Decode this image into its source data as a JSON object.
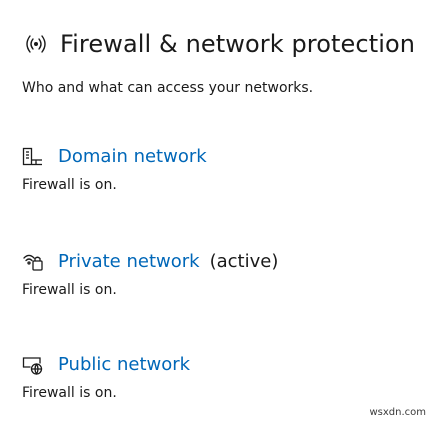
{
  "header": {
    "icon": "wifi-signal-icon",
    "title": "Firewall & network protection"
  },
  "subtitle": "Who and what can access your networks.",
  "networks": [
    {
      "icon": "domain-network-icon",
      "name": "Domain network",
      "active_label": "",
      "status": "Firewall is on."
    },
    {
      "icon": "private-network-icon",
      "name": "Private network",
      "active_label": "(active)",
      "status": "Firewall is on."
    },
    {
      "icon": "public-network-icon",
      "name": "Public network",
      "active_label": "",
      "status": "Firewall is on."
    }
  ],
  "watermark": "wsxdn.com",
  "colors": {
    "link": "#0067b8",
    "text": "#1a1a1a",
    "background": "#ffffff"
  }
}
